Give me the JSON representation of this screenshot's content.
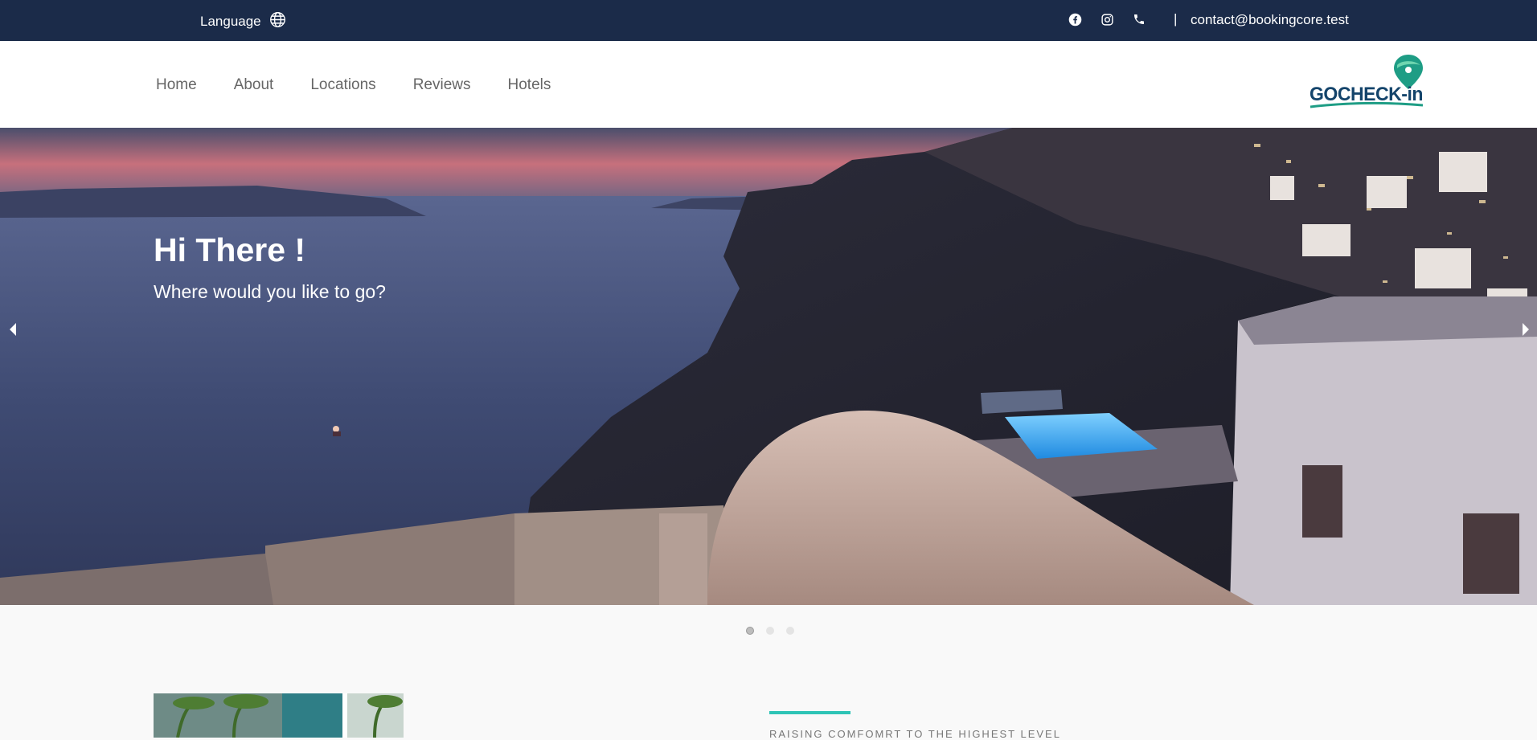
{
  "topbar": {
    "language_label": "Language",
    "separator": "|",
    "email": "contact@bookingcore.test",
    "icons": [
      "globe-icon",
      "facebook-icon",
      "instagram-icon",
      "phone-icon"
    ]
  },
  "nav": {
    "items": [
      {
        "label": "Home"
      },
      {
        "label": "About"
      },
      {
        "label": "Locations"
      },
      {
        "label": "Reviews"
      },
      {
        "label": "Hotels"
      }
    ]
  },
  "logo": {
    "text": "GOCHECK-in"
  },
  "hero": {
    "title": "Hi There !",
    "subtitle": "Where would you like to go?",
    "slide_count": 3,
    "active_slide": 1
  },
  "section": {
    "tagline": "RAISING COMFOMRT TO THE HIGHEST LEVEL"
  },
  "colors": {
    "topbar_bg": "#1b2b49",
    "accent": "#2ec4b6",
    "logo_dark": "#14446b"
  }
}
